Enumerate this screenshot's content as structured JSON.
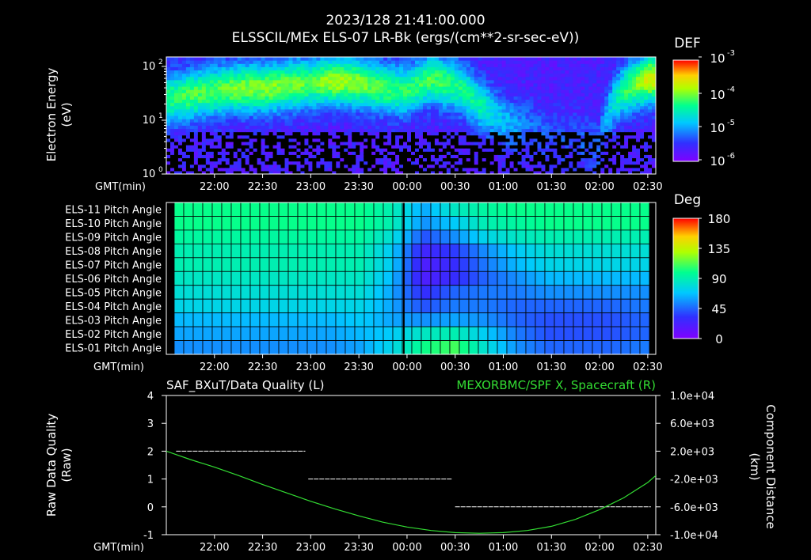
{
  "header": {
    "timestamp": "2023/128  21:41:00.000",
    "subtitle": "ELSSCIL/MEx ELS-07 LR-Bk   (ergs/(cm**2-sr-sec-eV))"
  },
  "time_axis": {
    "label": "GMT(min)",
    "ticks": [
      "22:00",
      "22:30",
      "23:00",
      "23:30",
      "00:00",
      "00:30",
      "01:00",
      "01:30",
      "02:00",
      "02:30"
    ],
    "range_minutes_from_2130": [
      0,
      305
    ]
  },
  "colors": {
    "spectrogram_scale": [
      "#7f00ff",
      "#3030ff",
      "#00c8ff",
      "#00ff90",
      "#b0ff00",
      "#ffd000",
      "#ff3000",
      "#ff0000"
    ],
    "line_green": "#33dd33",
    "right_title_green": "#33dd33",
    "quality_line": "#ffffff"
  },
  "chart_data": [
    {
      "type": "heatmap",
      "title": "ELSSCIL/MEx ELS-07 LR-Bk   (ergs/(cm**2-sr-sec-eV))",
      "ylabel": "Electron Energy (eV)",
      "y_scale": "log",
      "ylim": [
        1,
        150
      ],
      "y_ticks": [
        "10^0",
        "10^1",
        "10^2"
      ],
      "colorbar": {
        "label": "DEF",
        "scale": "log",
        "ticks": [
          "10^-3",
          "10^-4",
          "10^-5",
          "10^-6"
        ],
        "range": [
          1e-06,
          0.001
        ]
      },
      "band_profile": {
        "x_minutes": [
          0,
          15,
          30,
          45,
          60,
          75,
          90,
          105,
          120,
          135,
          150,
          165,
          180,
          195,
          210,
          225,
          240,
          255,
          270,
          285,
          300
        ],
        "peak_energy_eV": [
          25,
          30,
          35,
          40,
          40,
          45,
          50,
          55,
          50,
          40,
          35,
          60,
          45,
          20,
          10,
          8,
          5,
          5,
          3,
          35,
          60
        ],
        "intensity_level": [
          0.45,
          0.5,
          0.5,
          0.55,
          0.55,
          0.55,
          0.5,
          0.6,
          0.55,
          0.5,
          0.45,
          0.5,
          0.45,
          0.4,
          0.25,
          0.15,
          0.1,
          0.1,
          0.15,
          0.45,
          0.65
        ]
      }
    },
    {
      "type": "heatmap",
      "title": "",
      "ylabel": "",
      "rows": [
        "ELS-11 Pitch Angle",
        "ELS-10 Pitch Angle",
        "ELS-09 Pitch Angle",
        "ELS-08 Pitch Angle",
        "ELS-07 Pitch Angle",
        "ELS-06 Pitch Angle",
        "ELS-05 Pitch Angle",
        "ELS-04 Pitch Angle",
        "ELS-03 Pitch Angle",
        "ELS-02 Pitch Angle",
        "ELS-01 Pitch Angle"
      ],
      "colorbar": {
        "label": "Deg",
        "ticks": [
          "180",
          "135",
          "90",
          "45",
          "0"
        ],
        "range": [
          0,
          180
        ]
      },
      "column_minutes": [
        0,
        20,
        40,
        60,
        80,
        100,
        120,
        140,
        160,
        180,
        200,
        220,
        240,
        260,
        280,
        300
      ],
      "values_deg": [
        [
          100,
          100,
          100,
          100,
          100,
          100,
          100,
          90,
          60,
          85,
          95,
          100,
          100,
          100,
          100,
          100
        ],
        [
          100,
          100,
          100,
          100,
          100,
          100,
          100,
          90,
          55,
          70,
          90,
          95,
          100,
          100,
          100,
          100
        ],
        [
          95,
          95,
          95,
          95,
          95,
          95,
          95,
          80,
          40,
          55,
          75,
          85,
          90,
          90,
          90,
          90
        ],
        [
          90,
          90,
          90,
          90,
          90,
          90,
          90,
          70,
          25,
          35,
          55,
          70,
          80,
          80,
          80,
          80
        ],
        [
          90,
          90,
          90,
          90,
          90,
          90,
          90,
          70,
          20,
          30,
          50,
          65,
          75,
          75,
          75,
          75
        ],
        [
          85,
          85,
          85,
          85,
          85,
          85,
          85,
          65,
          20,
          30,
          45,
          55,
          65,
          65,
          65,
          65
        ],
        [
          80,
          80,
          80,
          80,
          80,
          80,
          80,
          60,
          30,
          45,
          50,
          50,
          55,
          55,
          55,
          55
        ],
        [
          75,
          75,
          75,
          75,
          75,
          75,
          75,
          60,
          40,
          50,
          50,
          45,
          45,
          45,
          45,
          50
        ],
        [
          65,
          65,
          65,
          65,
          65,
          65,
          70,
          60,
          55,
          60,
          55,
          45,
          40,
          40,
          40,
          45
        ],
        [
          60,
          60,
          60,
          60,
          60,
          60,
          65,
          70,
          85,
          90,
          70,
          50,
          40,
          40,
          40,
          45
        ],
        [
          55,
          55,
          55,
          55,
          55,
          55,
          60,
          75,
          100,
          110,
          80,
          55,
          45,
          45,
          45,
          50
        ]
      ]
    },
    {
      "type": "line",
      "title": "SAF_BXuT/Data Quality (L)",
      "right_title": "MEXORBMC/SPF X, Spacecraft (R)",
      "ylabel": "Raw Data Quality (Raw)",
      "ylabel_right": "Component Distance (km)",
      "ylim": [
        -1,
        4
      ],
      "y_ticks": [
        "4",
        "3",
        "2",
        "1",
        "0",
        "-1"
      ],
      "ylim_right": [
        -10000,
        10000
      ],
      "y_ticks_right": [
        "1.0e+04",
        "6.0e+03",
        "2.0e+03",
        "-2.0e+03",
        "-6.0e+03",
        "-1.0e+04"
      ],
      "series": [
        {
          "name": "SAF_BXuT/Data Quality",
          "axis": "left",
          "segments": [
            {
              "x_start_min": 10,
              "x_end_min": 142,
              "y": 2
            },
            {
              "x_start_min": 145,
              "x_end_min": 292,
              "y": 1
            },
            {
              "x_start_min": 295,
              "x_end_min": 495,
              "y": 0
            }
          ]
        },
        {
          "name": "MEXORBMC/SPF X, Spacecraft",
          "axis": "right",
          "x_minutes": [
            0,
            15,
            30,
            45,
            60,
            75,
            90,
            105,
            120,
            135,
            150,
            165,
            180,
            195,
            210,
            225,
            240,
            255,
            270,
            285,
            300,
            305
          ],
          "values": [
            2000,
            800,
            -300,
            -1500,
            -2800,
            -4000,
            -5200,
            -6300,
            -7300,
            -8200,
            -8900,
            -9400,
            -9700,
            -9800,
            -9700,
            -9400,
            -8800,
            -7800,
            -6400,
            -4700,
            -2500,
            -1500
          ]
        }
      ]
    }
  ]
}
